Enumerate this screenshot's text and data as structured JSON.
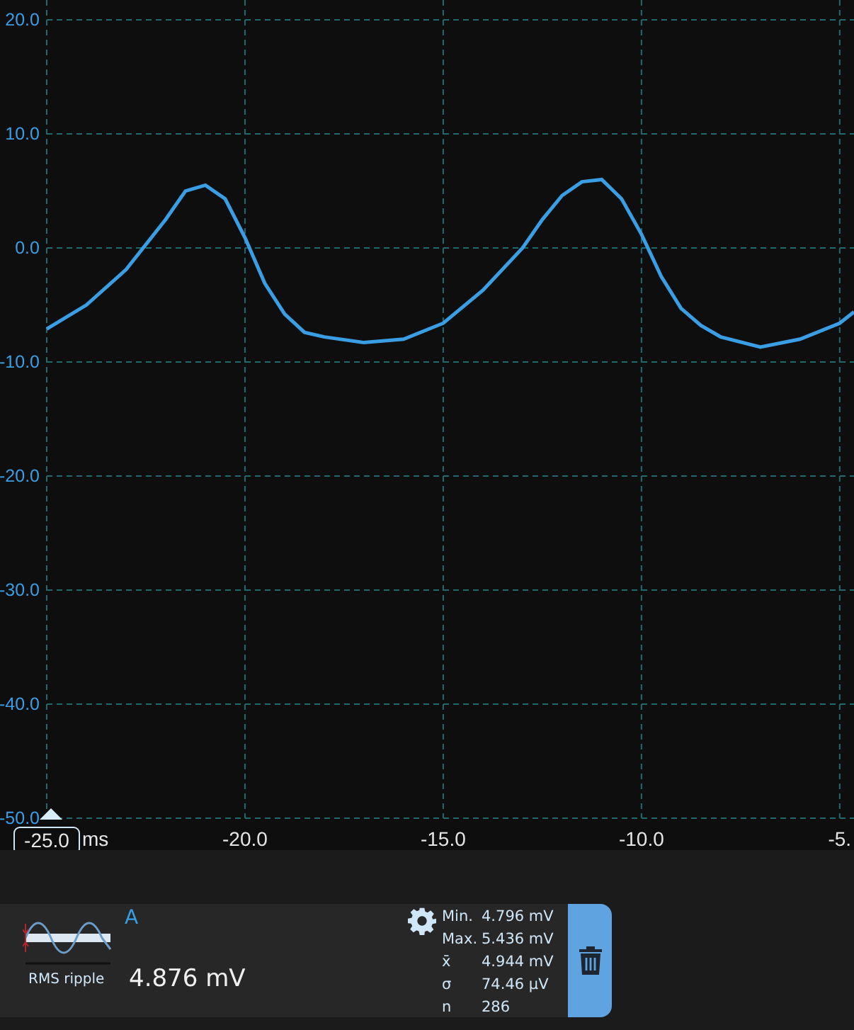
{
  "chart": {
    "chart_data": {
      "type": "line",
      "xlabel": "ms",
      "xlim": [
        -25,
        -4.64
      ],
      "ylim": [
        -50,
        21.74
      ],
      "grid": true,
      "xticks": [
        {
          "value": -20,
          "label": "-20.0"
        },
        {
          "value": -15,
          "label": "-15.0"
        },
        {
          "value": -10,
          "label": "-10.0"
        },
        {
          "value": -5,
          "label": "-5."
        }
      ],
      "yticks": [
        {
          "value": 20,
          "label": "20.0"
        },
        {
          "value": 10,
          "label": "10.0"
        },
        {
          "value": 0,
          "label": "0.0"
        },
        {
          "value": -10,
          "label": "-10.0"
        },
        {
          "value": -20,
          "label": "-20.0"
        },
        {
          "value": -30,
          "label": "-30.0"
        },
        {
          "value": -40,
          "label": "-40.0"
        },
        {
          "value": -50,
          "label": "-50.0"
        }
      ],
      "x": [
        -25,
        -24,
        -23,
        -22,
        -21.5,
        -21,
        -20.5,
        -20,
        -19.5,
        -19,
        -18.5,
        -18,
        -17,
        -16,
        -15,
        -14,
        -13,
        -12.5,
        -12,
        -11.5,
        -11,
        -10.5,
        -10,
        -9.5,
        -9,
        -8.5,
        -8,
        -7,
        -6,
        -5,
        -4.64
      ],
      "series": [
        {
          "name": "A",
          "color": "#3a9ee4",
          "values": [
            -7.1,
            -5,
            -1.9,
            2.5,
            5,
            5.5,
            4.3,
            0.9,
            -3.1,
            -5.8,
            -7.4,
            -7.8,
            -8.3,
            -8,
            -6.6,
            -3.7,
            0,
            2.5,
            4.6,
            5.8,
            6,
            4.3,
            1.2,
            -2.5,
            -5.3,
            -6.8,
            -7.8,
            -8.7,
            -8,
            -6.6,
            -5.6
          ]
        }
      ]
    },
    "cursor": {
      "label": "-25.0"
    }
  },
  "measurement": {
    "name": "RMS ripple",
    "value": "4.876 mV",
    "stats": [
      {
        "label": "Min.",
        "value": "4.796 mV"
      },
      {
        "label": "Max.",
        "value": "5.436 mV"
      },
      {
        "label": "x̄",
        "value": "4.944 mV"
      },
      {
        "label": "σ",
        "value": "74.46 µV"
      },
      {
        "label": "n",
        "value": "286"
      }
    ]
  }
}
